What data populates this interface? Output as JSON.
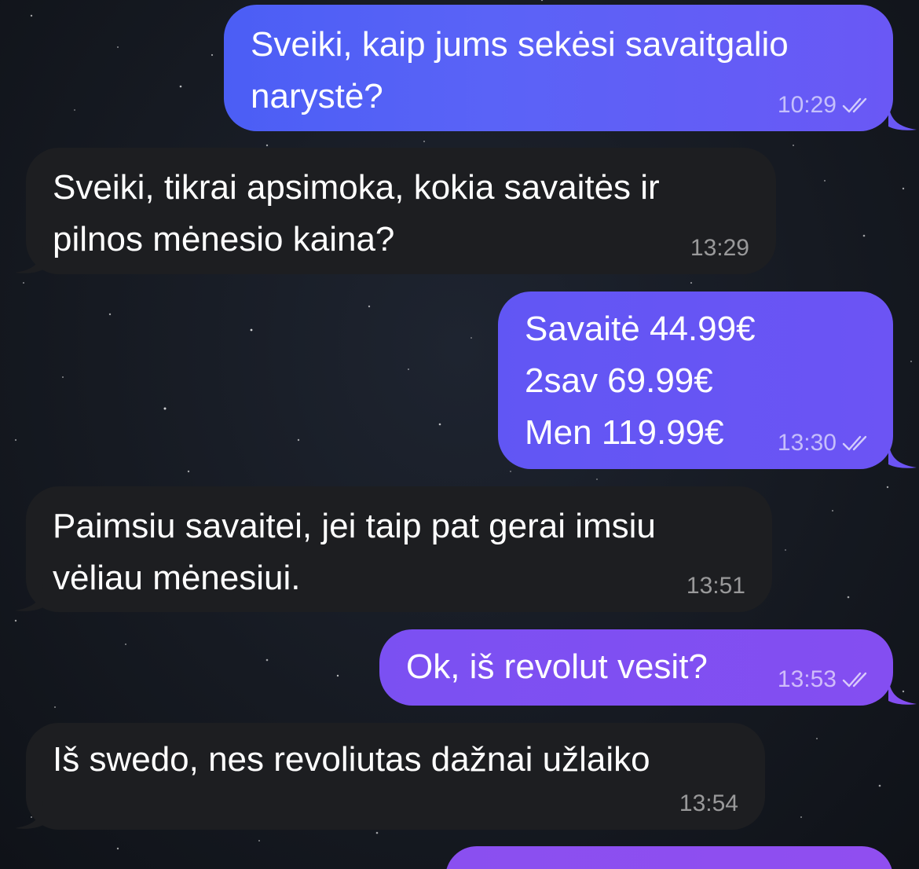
{
  "colors": {
    "outgoing_start": "#4b5ef5",
    "outgoing_end": "#6a58f5",
    "outgoing_violet": "#8a4ff0",
    "incoming": "#1d1e21",
    "background": "#161a22"
  },
  "messages": [
    {
      "direction": "outgoing",
      "text": "Sveiki, kaip jums sekėsi savaitgalio\nnarystė?",
      "time": "10:29",
      "status_icon": "double-check-icon"
    },
    {
      "direction": "incoming",
      "text": "Sveiki, tikrai apsimoka, kokia savaitės ir\npilnos mėnesio kaina?",
      "time": "13:29"
    },
    {
      "direction": "outgoing",
      "text": "Savaitė 44.99€\n2sav 69.99€\nMen 119.99€",
      "time": "13:30",
      "status_icon": "double-check-icon"
    },
    {
      "direction": "incoming",
      "text": "Paimsiu savaitei, jei taip pat gerai imsiu\nvėliau mėnesiui.",
      "time": "13:51"
    },
    {
      "direction": "outgoing",
      "text": "Ok, iš revolut vesit?",
      "time": "13:53",
      "status_icon": "double-check-icon"
    },
    {
      "direction": "incoming",
      "text": "Iš swedo, nes revoliutas dažnai užlaiko",
      "time": "13:54"
    }
  ]
}
